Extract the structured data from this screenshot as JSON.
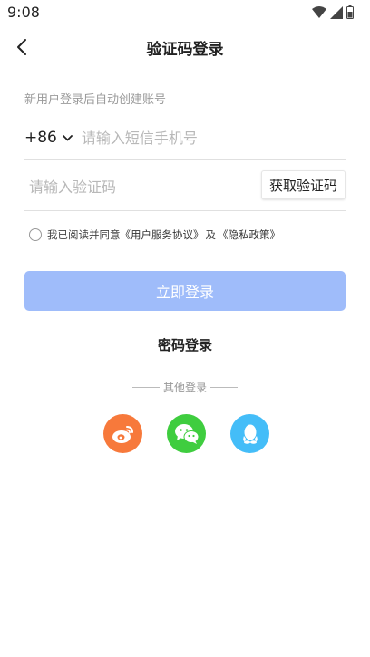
{
  "status": {
    "time": "9:08"
  },
  "nav": {
    "title": "验证码登录"
  },
  "form": {
    "hint": "新用户登录后自动创建账号",
    "country_code": "+86",
    "phone_placeholder": "请输入短信手机号",
    "code_placeholder": "请输入验证码",
    "get_code_label": "获取验证码"
  },
  "agreement": {
    "prefix": "我已阅读并同意",
    "user_agreement": "《用户服务协议》",
    "and": "及",
    "privacy_policy": "《隐私政策》"
  },
  "login_button": "立即登录",
  "password_login": "密码登录",
  "other_login": {
    "label": "其他登录"
  },
  "social": [
    {
      "name": "weibo",
      "icon": "weibo-icon",
      "color": "#f7793b"
    },
    {
      "name": "wechat",
      "icon": "wechat-icon",
      "color": "#3fcd3f"
    },
    {
      "name": "qq",
      "icon": "qq-icon",
      "color": "#44bdf8"
    }
  ],
  "colors": {
    "primary_disabled": "#9fbcfa"
  }
}
